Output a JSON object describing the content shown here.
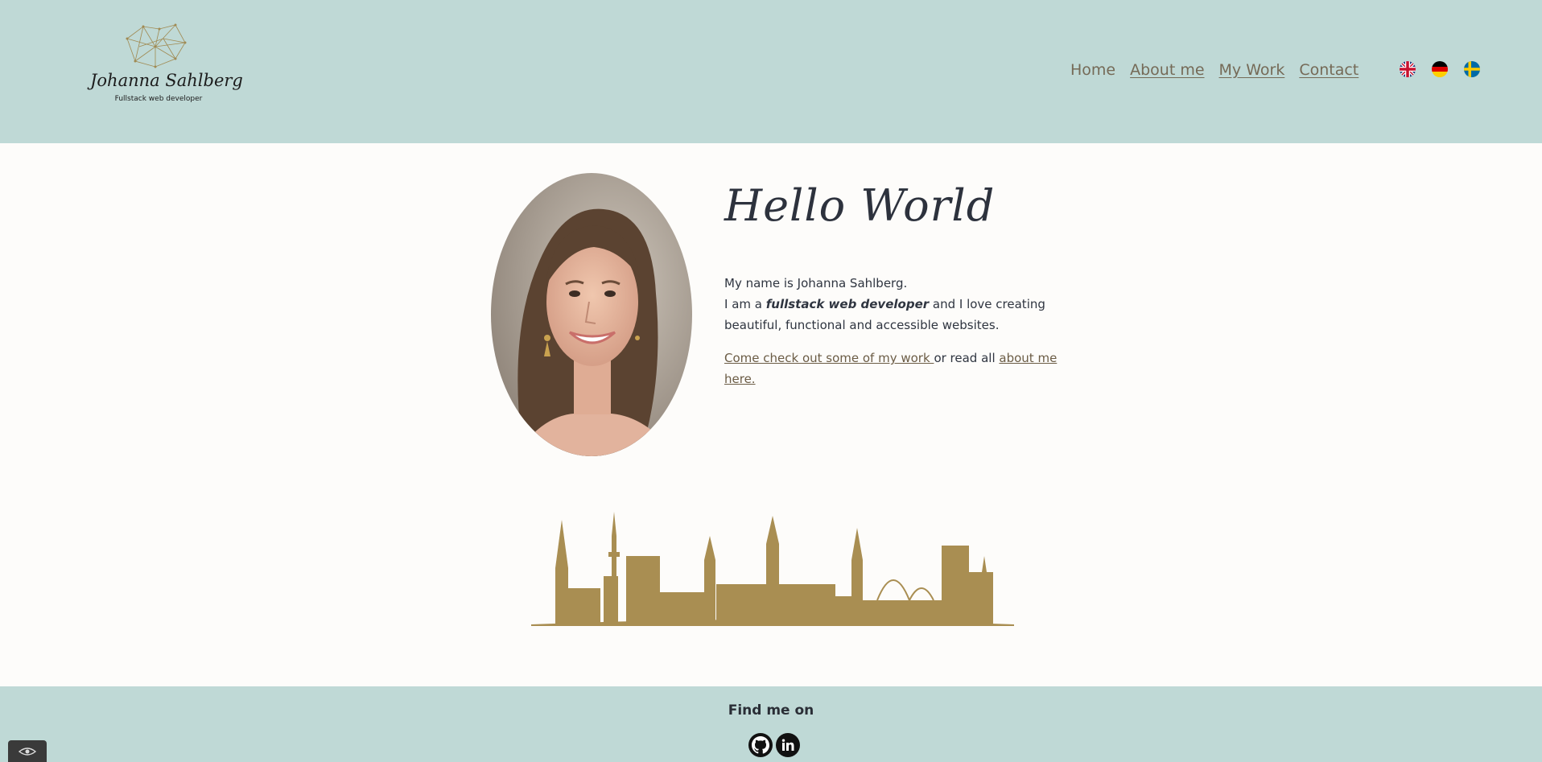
{
  "brand": {
    "name": "Johanna Sahlberg",
    "tagline": "Fullstack web developer"
  },
  "nav": {
    "items": [
      "Home",
      "About me",
      "My Work",
      "Contact"
    ],
    "active": "Home"
  },
  "languages": [
    "english-flag-icon",
    "german-flag-icon",
    "swedish-flag-icon"
  ],
  "hero": {
    "title": "Hello World",
    "line1": "My name is Johanna Sahlberg.",
    "line2_before": "I am a ",
    "line2_emphasis": "fullstack web developer",
    "line2_after": " and I love creating beautiful, functional and accessible websites.",
    "link_work": "Come check out some of my work ",
    "link_connector": "or read all ",
    "link_about": "about me here."
  },
  "footer": {
    "title": "Find me on",
    "socials": [
      "github-icon",
      "linkedin-icon"
    ]
  },
  "colors": {
    "header_bg": "#bfd9d6",
    "page_bg": "#fdfcfa",
    "accent_gold": "#a98e52",
    "link": "#6b5c45"
  }
}
